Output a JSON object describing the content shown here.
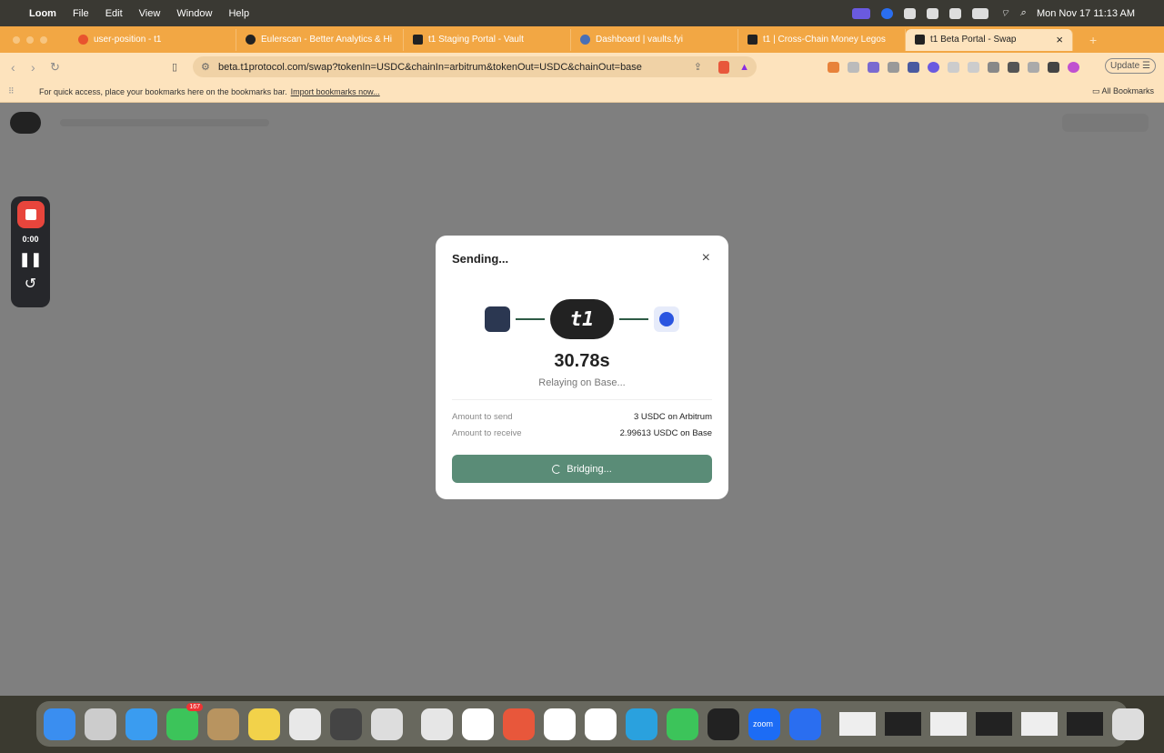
{
  "menubar": {
    "app": "Loom",
    "items": [
      "File",
      "Edit",
      "View",
      "Window",
      "Help"
    ],
    "clock": "Mon Nov 17  11:13 AM"
  },
  "tabs": [
    {
      "title": "user-position - t1",
      "color": "#e8542e"
    },
    {
      "title": "Eulerscan - Better Analytics & Hi",
      "color": "#222222"
    },
    {
      "title": "t1 Staging Portal - Vault",
      "color": "#222222"
    },
    {
      "title": "Dashboard | vaults.fyi",
      "color": "#4a6fb5"
    },
    {
      "title": "t1 | Cross-Chain Money Legos",
      "color": "#222222"
    },
    {
      "title": "t1 Beta Portal - Swap",
      "color": "#222222"
    }
  ],
  "tab_close": "×",
  "new_tab": "+",
  "address": {
    "url": "beta.t1protocol.com/swap?tokenIn=USDC&chainIn=arbitrum&tokenOut=USDC&chainOut=base",
    "update": "Update"
  },
  "bookmarks": {
    "hint": "For quick access, place your bookmarks here on the bookmarks bar.",
    "import": "Import bookmarks now...",
    "all": "All Bookmarks"
  },
  "loom": {
    "time": "0:00"
  },
  "modal": {
    "title": "Sending...",
    "close": "×",
    "logo": "t1",
    "timer": "30.78s",
    "status": "Relaying on Base...",
    "rows": [
      {
        "label": "Amount to send",
        "value": "3 USDC on Arbitrum"
      },
      {
        "label": "Amount to receive",
        "value": "2.99613 USDC on Base"
      }
    ],
    "button": "Bridging..."
  },
  "dock": {
    "messages_badge": "167",
    "zoom": "zoom",
    "apps": [
      "#3a8ef0",
      "#ccc",
      "#3a9cf0",
      "#3cc45a",
      "#b89460",
      "#f2d24a",
      "#e8e8e8",
      "#444",
      "#ddd",
      "#e6e6e6",
      "#fff",
      "#e8573b",
      "#fff",
      "#fff",
      "#2aa1de",
      "#3cc45a",
      "#222",
      "#1c6cf5",
      "#2a6ef0"
    ]
  }
}
